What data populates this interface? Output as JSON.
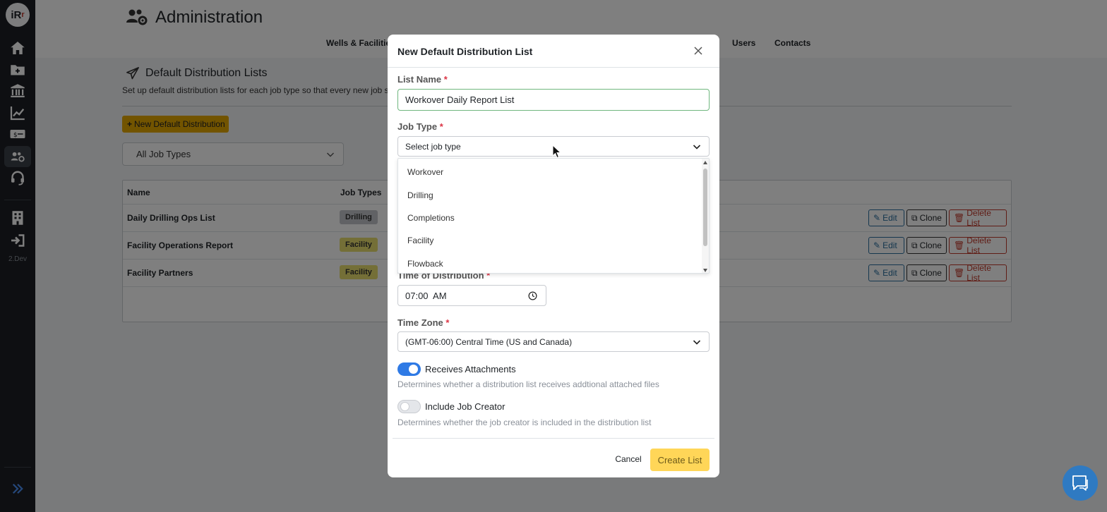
{
  "sidebar": {
    "logo_main": "iR",
    "logo_sub": "r",
    "icons": [
      "home-icon",
      "folder-plus-icon",
      "bank-icon",
      "chart-line-icon",
      "money-icon",
      "users-gear-icon",
      "headset-icon",
      "building-icon",
      "sign-out-icon"
    ],
    "version": "2.Dev"
  },
  "header": {
    "title": "Administration",
    "tabs": [
      "Wells & Facilities",
      "Users",
      "Contacts"
    ]
  },
  "main": {
    "page_title": "Default Distribution Lists",
    "description": "Set up default distribution lists for each job type so that every new job s",
    "new_button": "New Default Distribution",
    "filter_value": "All Job Types",
    "table": {
      "headers": [
        "Name",
        "Job Types"
      ],
      "rows": [
        {
          "name": "Daily Drilling Ops List",
          "job_type": "Drilling"
        },
        {
          "name": "Facility Operations Report",
          "job_type": "Facility"
        },
        {
          "name": "Facility Partners",
          "job_type": "Facility"
        }
      ],
      "actions": {
        "edit": "Edit",
        "clone": "Clone",
        "delete": "Delete List"
      }
    }
  },
  "modal": {
    "title": "New Default Distribution List",
    "list_name_label": "List Name",
    "list_name_value": "Workover Daily Report List",
    "job_type_label": "Job Type",
    "job_type_placeholder": "Select job type",
    "job_type_options": [
      "Workover",
      "Drilling",
      "Completions",
      "Facility",
      "Flowback"
    ],
    "time_label": "Time of Distribution",
    "time_value": "07:00  AM",
    "timezone_label": "Time Zone",
    "timezone_value": "(GMT-06:00) Central Time (US and Canada)",
    "receives_attachments": {
      "label": "Receives Attachments",
      "help": "Determines whether a distribution list receives addtional attached files",
      "on": true
    },
    "include_creator": {
      "label": "Include Job Creator",
      "help": "Determines whether the job creator is included in the distribution list",
      "on": false
    },
    "required_marker": "*",
    "cancel": "Cancel",
    "create": "Create List"
  },
  "colors": {
    "accent": "#e5a800",
    "toggle_on": "#2f7ae5",
    "required": "#dc3545",
    "chat": "#2f7ac2"
  }
}
